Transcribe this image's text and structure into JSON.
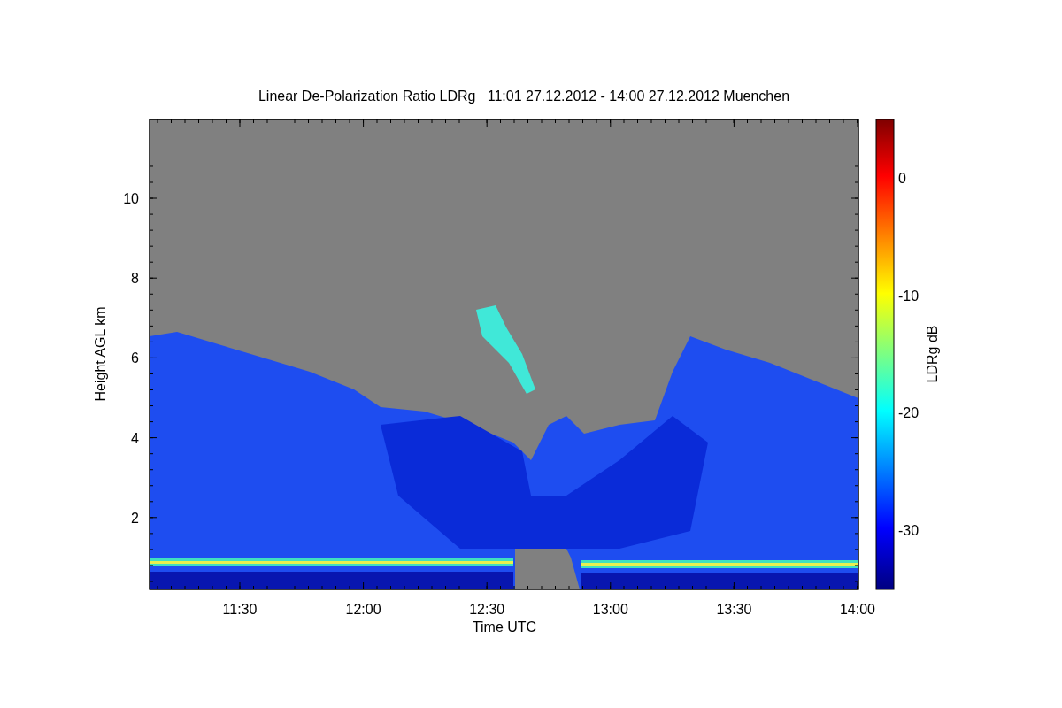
{
  "title": "Linear De-Polarization Ratio LDRg   11:01 27.12.2012 - 14:00 27.12.2012 Muenchen",
  "x_axis": {
    "label": "Time UTC",
    "ticks": [
      "11:30",
      "12:00",
      "12:30",
      "13:00",
      "13:30",
      "14:00"
    ]
  },
  "y_axis": {
    "label": "Height AGL km",
    "ticks": [
      "10",
      "8",
      "6",
      "4",
      "2"
    ]
  },
  "colorbar": {
    "label": "LDRg dB",
    "ticks": [
      "0",
      "-10",
      "-20",
      "-30"
    ]
  }
}
